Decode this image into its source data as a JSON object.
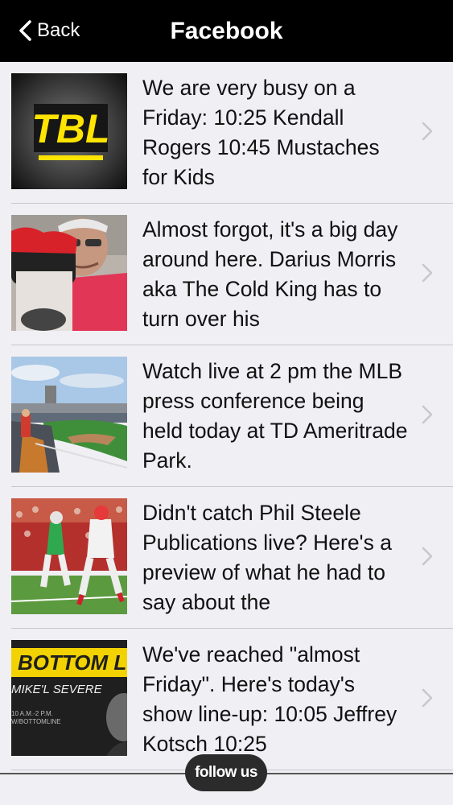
{
  "header": {
    "back_label": "Back",
    "title": "Facebook"
  },
  "feed": {
    "items": [
      {
        "thumb": "TBL logo",
        "thumb_text": "TBL",
        "text": "We are very busy on a Friday: 10:25 Kendall Rogers 10:45 Mustaches for Kids"
      },
      {
        "thumb": "man with puppet",
        "text": "Almost forgot, it's a big day around here. Darius Morris aka The Cold King has to turn over his"
      },
      {
        "thumb": "baseball stadium",
        "text": "Watch live at 2 pm the MLB press conference being held today at TD Ameritrade Park."
      },
      {
        "thumb": "football game",
        "text": "Didn't catch Phil Steele Publications live? Here's a preview of what he had to say about the"
      },
      {
        "thumb": "Bottom Line show",
        "thumb_text": "BOTTOM L",
        "thumb_sub": "MIKE'L SEVERE",
        "thumb_small1": "10 A.M.-2 P.M.",
        "thumb_small2": "W/BOTTOMLINE",
        "text": "We've reached \"almost Friday\". Here's today's show line-up: 10:05 Jeffrey Kotsch 10:25"
      }
    ]
  },
  "footer": {
    "follow_label": "follow us"
  },
  "colors": {
    "header_bg": "#000000",
    "page_bg": "#efeff4",
    "chevron": "#c7c7cc",
    "tbl_yellow": "#ffe400",
    "bottom_yellow": "#f2d200"
  }
}
